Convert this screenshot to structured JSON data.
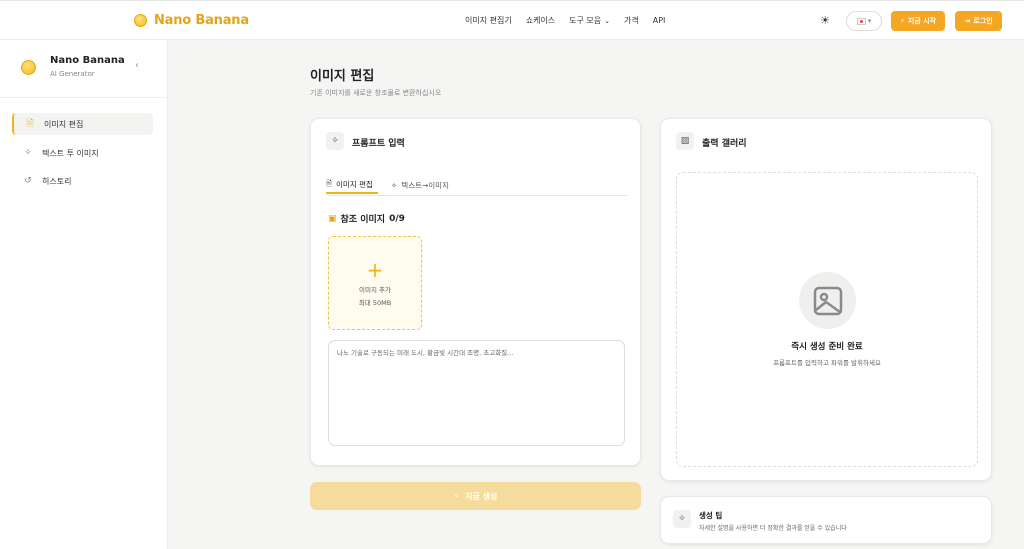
{
  "header": {
    "brand": "Nano Banana",
    "nav": [
      "이미지 편집기",
      "쇼케이스",
      "도구 모음",
      "가격",
      "API"
    ],
    "start_label": "지금 시작",
    "login_label": "로그인"
  },
  "sidebar": {
    "title": "Nano Banana",
    "subtitle": "AI Generator",
    "items": [
      {
        "label": "이미지 편집",
        "icon": "image-edit-icon",
        "active": true
      },
      {
        "label": "텍스트 투 이미지",
        "icon": "magic-wand-icon",
        "active": false
      },
      {
        "label": "히스토리",
        "icon": "history-icon",
        "active": false
      }
    ]
  },
  "main": {
    "title": "이미지 편집",
    "subtitle": "기존 이미지를 새로운 창조물로 변환하십시오"
  },
  "prompt_card": {
    "title": "프롬프트 입력",
    "tabs": [
      "이미지 편집",
      "텍스트→이미지"
    ],
    "ref_label": "참조 이미지",
    "ref_count": "0/9",
    "upload_label": "이미지 추가",
    "upload_limit": "최대 50MB",
    "placeholder": "나노 기술로 구동되는 미래 도시, 황금빛 시간대 조명, 초고화질..."
  },
  "generate_label": "지금 생성",
  "gallery_card": {
    "title": "출력 갤러리",
    "empty_title": "즉시 생성 준비 완료",
    "empty_sub": "프롬프트를 입력하고 파워를 발휘하세요"
  },
  "tip_card": {
    "title": "생성 팁",
    "text": "자세한 설명을 사용하면 더 정확한 결과를 얻을 수 있습니다"
  },
  "colors": {
    "accent": "#f5a623",
    "brand_text": "#e6a317",
    "generate_disabled": "#f6dc9c"
  }
}
